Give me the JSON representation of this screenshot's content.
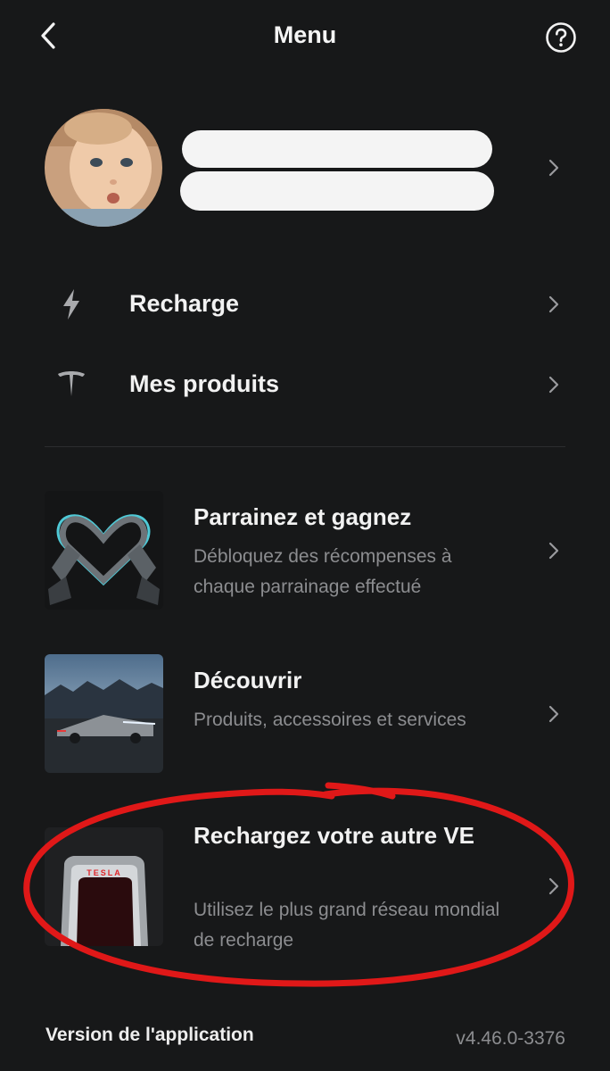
{
  "header": {
    "title": "Menu"
  },
  "nav": [
    {
      "label": "Recharge",
      "icon": "bolt-icon"
    },
    {
      "label": "Mes produits",
      "icon": "tesla-logo-icon"
    }
  ],
  "cards": [
    {
      "title": "Parrainez et gagnez",
      "description": "Débloquez des récompenses à chaque parrainage effectué",
      "image": "heart-hands-image"
    },
    {
      "title": "Découvrir",
      "description": "Produits, accessoires et services",
      "image": "cybertruck-image"
    },
    {
      "title": "Rechargez votre autre VE",
      "description": "Utilisez le plus grand réseau mondial de recharge",
      "image": "supercharger-image",
      "image_text": "TESLA"
    }
  ],
  "footer": {
    "version_label": "Version de l'application",
    "version_value": "v4.46.0-3376"
  },
  "colors": {
    "background": "#171819",
    "text": "#f2f2f2",
    "secondary_text": "#8c8d90",
    "annotation": "#e01818"
  }
}
